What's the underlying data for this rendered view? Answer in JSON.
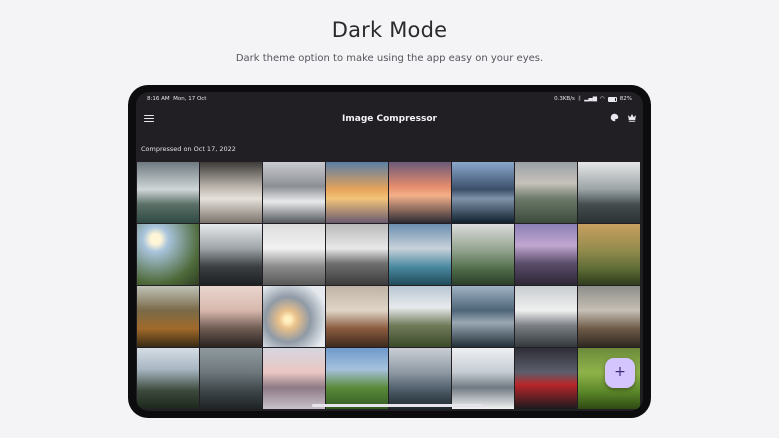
{
  "promo": {
    "title": "Dark Mode",
    "subtitle": "Dark theme option to make using the app easy on your eyes."
  },
  "statusbar": {
    "time": "8:16 AM",
    "date": "Mon, 17 Oct",
    "network_speed": "0.3KB/s",
    "battery": "82%"
  },
  "appbar": {
    "title": "Image Compressor",
    "icons": [
      "menu-icon",
      "palette-icon",
      "crown-icon"
    ]
  },
  "section": {
    "label": "Compressed on Oct 17, 2022"
  },
  "gallery": {
    "thumbnails": [
      [
        "waterfall",
        "clouds",
        "snowy-peaks",
        "sunset-sky",
        "pink-sunset-mountain",
        "blue-lake-mountains",
        "cliff-valley",
        "misty-ridge"
      ],
      [
        "sun-over-hills",
        "snowy-forest",
        "foggy-peaks",
        "snow-ridge",
        "glacier-lake",
        "green-slope",
        "purple-dusk-peaks",
        "golden-valley"
      ],
      [
        "autumn-forest",
        "woman-on-hill",
        "winter-sunrise-tree",
        "desert-rocks",
        "alpine-meadow",
        "dark-valley",
        "snow-range",
        "rocky-fog"
      ],
      [
        "pine-forest",
        "misty-forest",
        "pink-lakeshore",
        "green-hills",
        "alpine-village",
        "snowy-summit",
        "red-boat",
        "tea-field"
      ]
    ]
  },
  "fab": {
    "icon": "plus-icon",
    "label": "+"
  },
  "colors": {
    "page_background": "#f4f3f6",
    "screen_background": "#211f24",
    "fab_background": "#d4c5ff"
  }
}
